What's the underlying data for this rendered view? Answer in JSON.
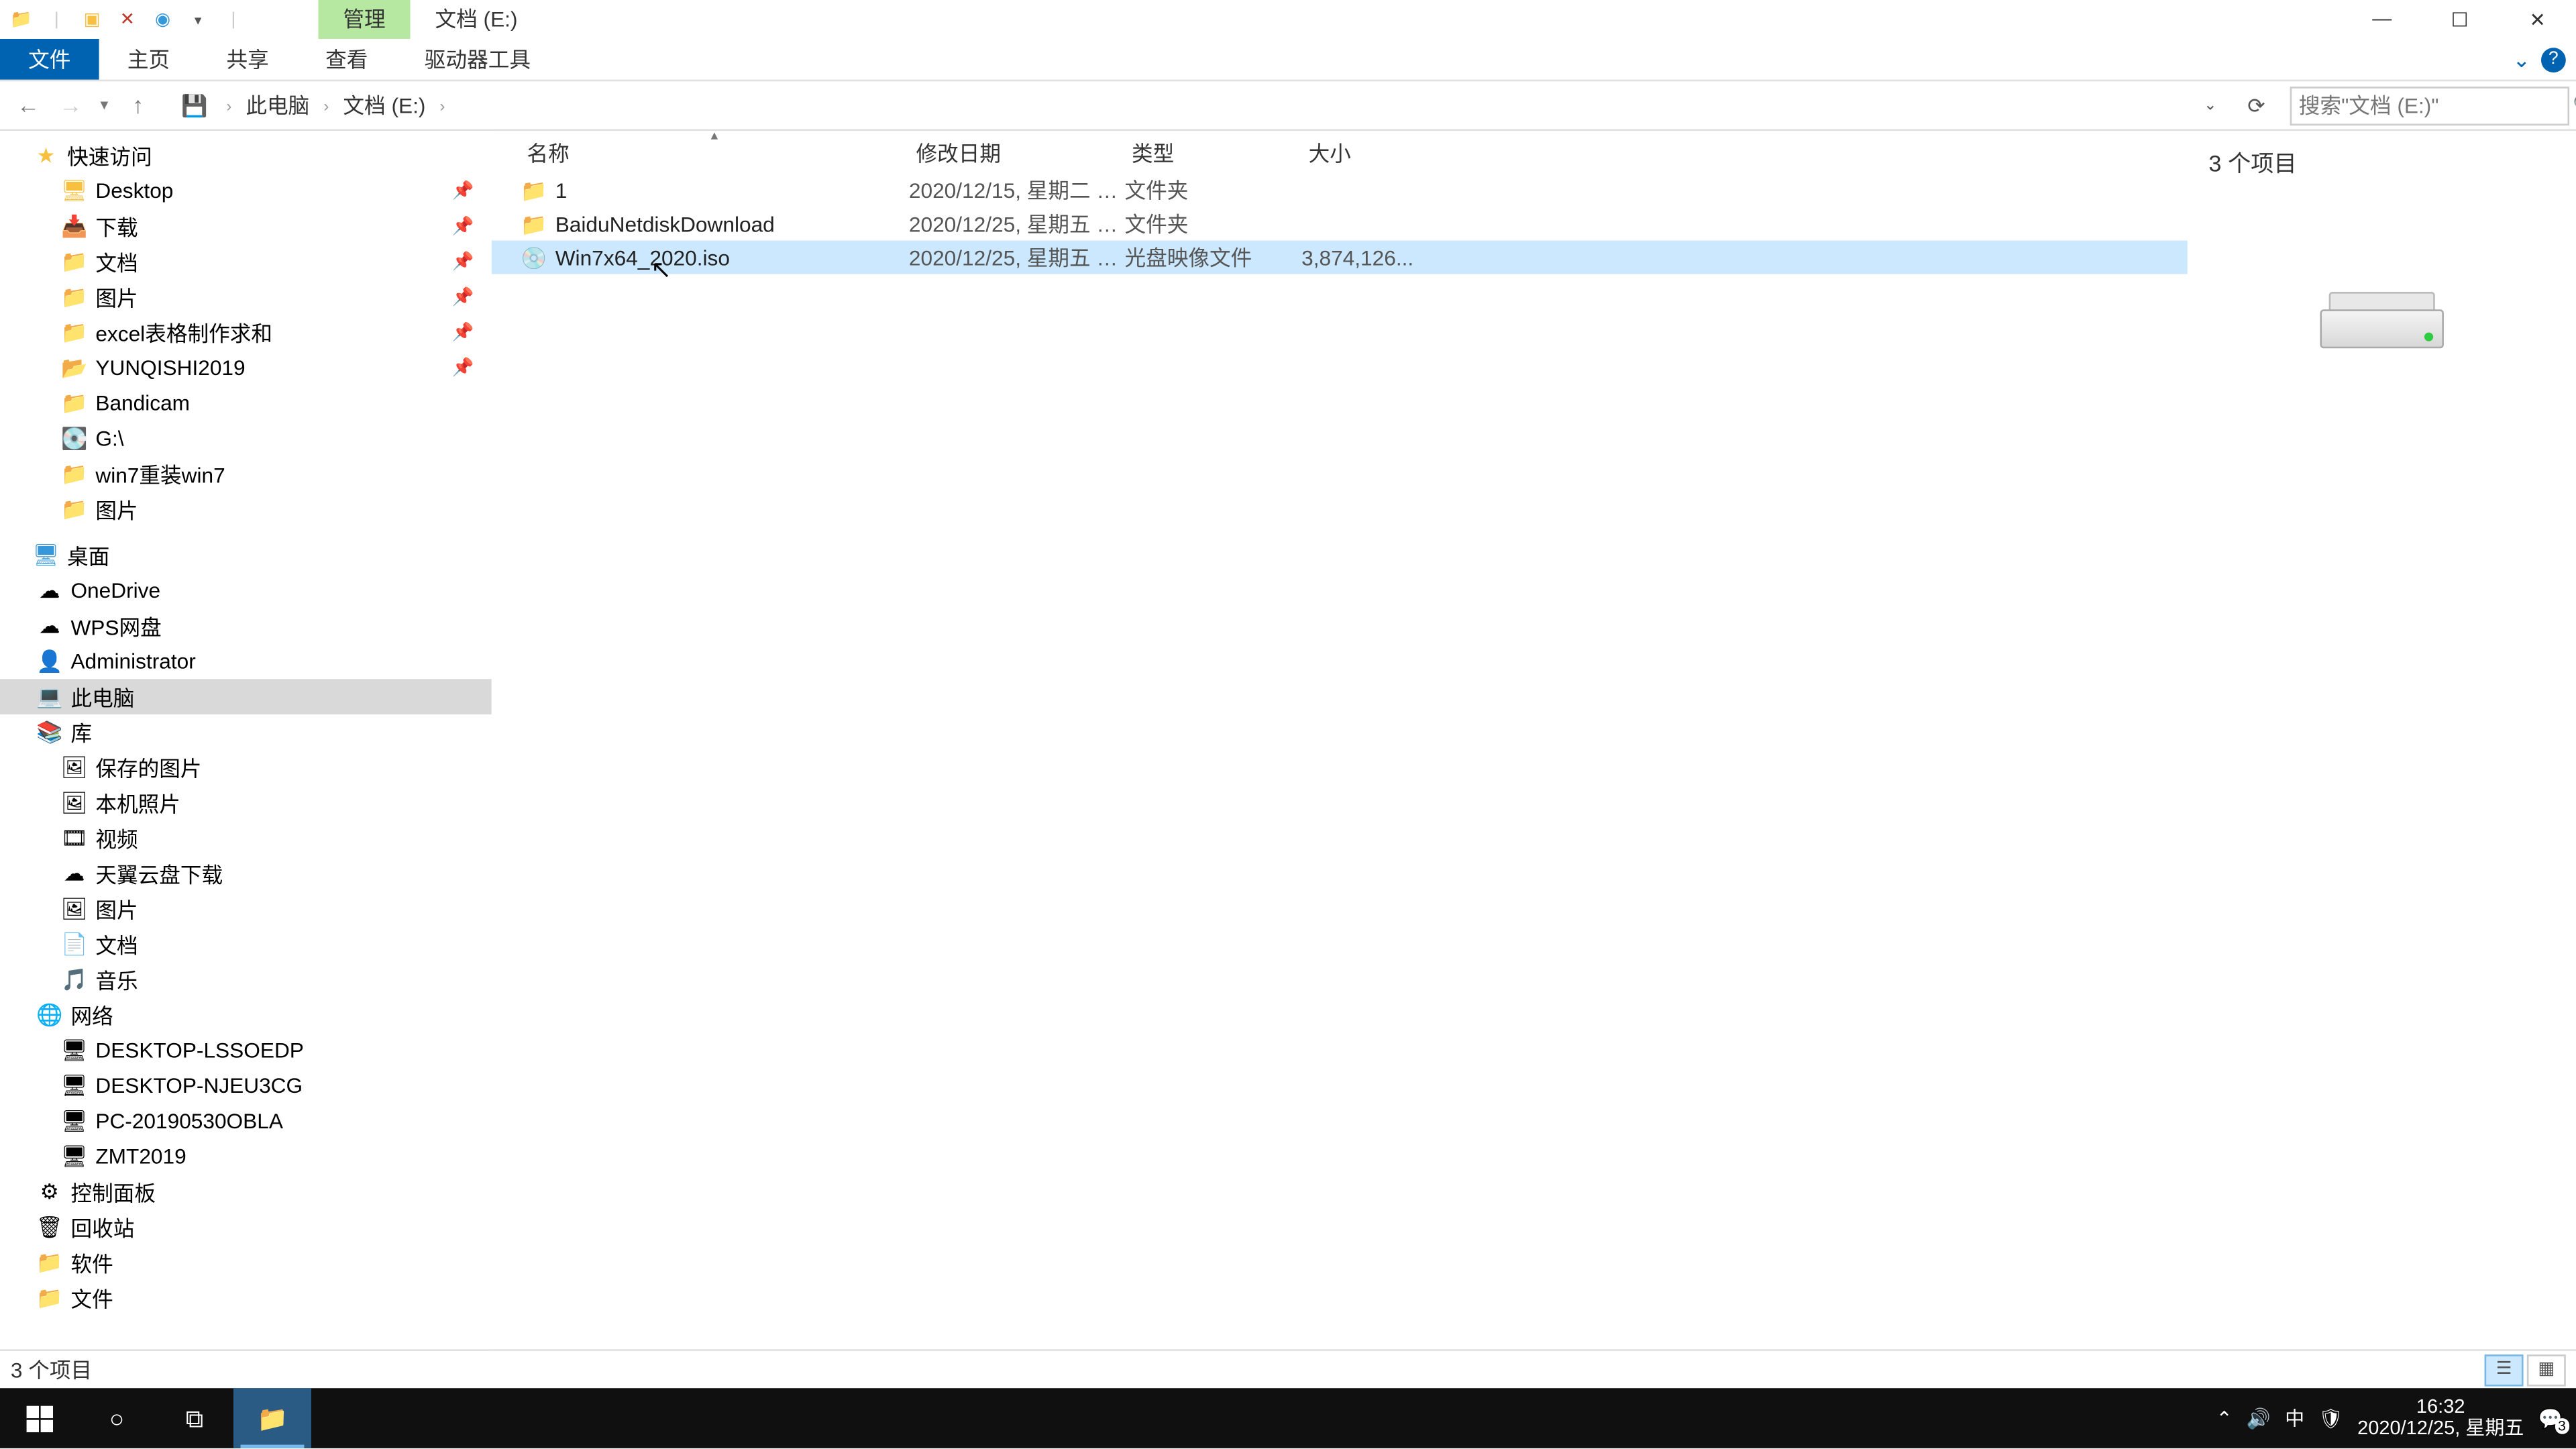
{
  "titlebar": {
    "context_tab": "管理",
    "window_title": "文档 (E:)"
  },
  "ribbon": {
    "file": "文件",
    "home": "主页",
    "share": "共享",
    "view": "查看",
    "drive_tools": "驱动器工具"
  },
  "address": {
    "crumb_pc": "此电脑",
    "crumb_drive": "文档 (E:)"
  },
  "search": {
    "placeholder": "搜索\"文档 (E:)\""
  },
  "nav": {
    "quick_access": "快速访问",
    "quick_items": [
      {
        "label": "Desktop",
        "pinned": true,
        "icon": "desktop"
      },
      {
        "label": "下载",
        "pinned": true,
        "icon": "folder-blue"
      },
      {
        "label": "文档",
        "pinned": true,
        "icon": "folder"
      },
      {
        "label": "图片",
        "pinned": true,
        "icon": "folder"
      },
      {
        "label": "excel表格制作求和",
        "pinned": true,
        "icon": "folder"
      },
      {
        "label": "YUNQISHI2019",
        "pinned": true,
        "icon": "folder-app"
      },
      {
        "label": "Bandicam",
        "pinned": false,
        "icon": "folder"
      },
      {
        "label": "G:\\",
        "pinned": false,
        "icon": "drive"
      },
      {
        "label": "win7重装win7",
        "pinned": false,
        "icon": "folder"
      },
      {
        "label": "图片",
        "pinned": false,
        "icon": "folder"
      }
    ],
    "desktop": "桌面",
    "desktop_items": [
      {
        "label": "OneDrive",
        "icon": "onedrive"
      },
      {
        "label": "WPS网盘",
        "icon": "wps"
      },
      {
        "label": "Administrator",
        "icon": "user"
      },
      {
        "label": "此电脑",
        "icon": "pc",
        "selected": true
      },
      {
        "label": "库",
        "icon": "library"
      },
      {
        "label": "保存的图片",
        "icon": "pictures",
        "lvl": 2
      },
      {
        "label": "本机照片",
        "icon": "pictures",
        "lvl": 2
      },
      {
        "label": "视频",
        "icon": "video",
        "lvl": 2
      },
      {
        "label": "天翼云盘下载",
        "icon": "cloud",
        "lvl": 2
      },
      {
        "label": "图片",
        "icon": "pictures",
        "lvl": 2
      },
      {
        "label": "文档",
        "icon": "docs",
        "lvl": 2
      },
      {
        "label": "音乐",
        "icon": "music",
        "lvl": 2
      },
      {
        "label": "网络",
        "icon": "network"
      },
      {
        "label": "DESKTOP-LSSOEDP",
        "icon": "pc-net",
        "lvl": 2
      },
      {
        "label": "DESKTOP-NJEU3CG",
        "icon": "pc-net",
        "lvl": 2
      },
      {
        "label": "PC-20190530OBLA",
        "icon": "pc-net",
        "lvl": 2
      },
      {
        "label": "ZMT2019",
        "icon": "pc-net",
        "lvl": 2
      },
      {
        "label": "控制面板",
        "icon": "control"
      },
      {
        "label": "回收站",
        "icon": "recycle"
      },
      {
        "label": "软件",
        "icon": "folder"
      },
      {
        "label": "文件",
        "icon": "folder"
      }
    ]
  },
  "columns": {
    "name": "名称",
    "date": "修改日期",
    "type": "类型",
    "size": "大小"
  },
  "files": [
    {
      "name": "1",
      "date": "2020/12/15, 星期二 1...",
      "type": "文件夹",
      "size": "",
      "icon": "folder"
    },
    {
      "name": "BaiduNetdiskDownload",
      "date": "2020/12/25, 星期五 1...",
      "type": "文件夹",
      "size": "",
      "icon": "folder"
    },
    {
      "name": "Win7x64_2020.iso",
      "date": "2020/12/25, 星期五 1...",
      "type": "光盘映像文件",
      "size": "3,874,126...",
      "icon": "disc",
      "selected": true
    }
  ],
  "preview": {
    "count_label": "3 个项目"
  },
  "status": {
    "text": "3 个项目"
  },
  "taskbar": {
    "time": "16:32",
    "date": "2020/12/25, 星期五",
    "ime": "中",
    "notif_badge": "3"
  }
}
